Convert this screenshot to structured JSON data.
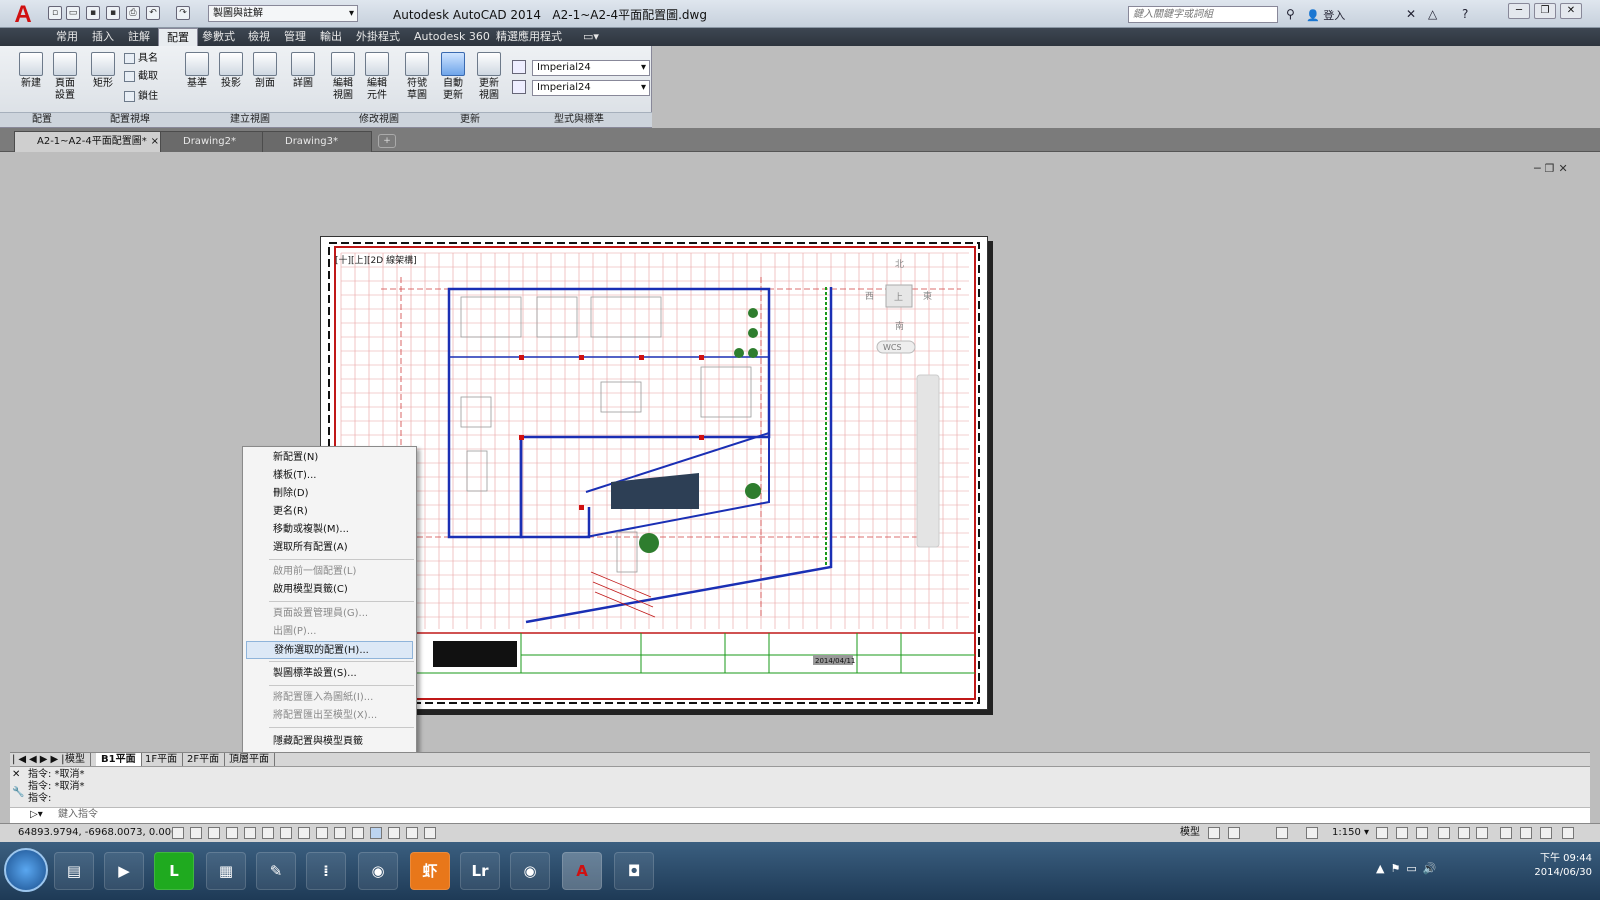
{
  "window": {
    "app_title": "Autodesk AutoCAD 2014",
    "file_name": "A2-1~A2-4平面配置圖.dwg",
    "workspace": "製圖與註解",
    "search_placeholder": "鍵入關鍵字或詞組",
    "login": "登入"
  },
  "menu_tabs": [
    "常用",
    "插入",
    "註解",
    "配置",
    "參數式",
    "檢視",
    "管理",
    "輸出",
    "外掛程式",
    "Autodesk 360",
    "精選應用程式"
  ],
  "ribbon": {
    "btn_new": "新建",
    "btn_page": "頁面 設置",
    "btn_rect": "矩形",
    "btn_named": "具名",
    "btn_clip": "截取",
    "btn_lock": "鎖住",
    "btn_base": "基準",
    "btn_proj": "投影",
    "btn_section": "剖面",
    "btn_detail": "詳圖",
    "btn_edit_view": "編輯 視圖",
    "btn_edit_comp": "編輯 元件",
    "btn_symbol": "符號 草圖",
    "btn_auto": "自動 更新",
    "btn_update": "更新 視圖",
    "style1": "Imperial24",
    "style2": "Imperial24",
    "panel_layout": "配置",
    "panel_vp": "配置視埠",
    "panel_create": "建立視圖",
    "panel_modify": "修改視圖",
    "panel_update": "更新",
    "panel_styles": "型式與標準"
  },
  "doc_tabs": [
    "A2-1~A2-4平面配置圖*",
    "Drawing2*",
    "Drawing3*"
  ],
  "drawing": {
    "view_label": "[十][上][2D 線架構]",
    "compass_n": "北",
    "compass_s": "南",
    "compass_e": "東",
    "compass_w": "西",
    "compass_top": "上",
    "wcs": "WCS",
    "date": "2014/04/11"
  },
  "context_menu": {
    "items": [
      {
        "label": "新配置(N)",
        "enabled": true
      },
      {
        "label": "樣板(T)...",
        "enabled": true
      },
      {
        "label": "刪除(D)",
        "enabled": true
      },
      {
        "label": "更名(R)",
        "enabled": true
      },
      {
        "label": "移動或複製(M)...",
        "enabled": true
      },
      {
        "label": "選取所有配置(A)",
        "enabled": true
      },
      {
        "label": "啟用前一個配置(L)",
        "enabled": false
      },
      {
        "label": "啟用模型頁籤(C)",
        "enabled": true
      },
      {
        "label": "頁面設置管理員(G)...",
        "enabled": false
      },
      {
        "label": "出圖(P)...",
        "enabled": false
      },
      {
        "label": "發佈選取的配置(H)...",
        "enabled": true
      },
      {
        "label": "製圖標準設置(S)...",
        "enabled": true
      },
      {
        "label": "將配置匯入為圖紙(I)...",
        "enabled": false
      },
      {
        "label": "將配置匯出至模型(X)...",
        "enabled": false
      },
      {
        "label": "隱藏配置與模型頁籤",
        "enabled": true
      }
    ]
  },
  "layout_tabs": [
    "模型",
    "B1平面",
    "1F平面",
    "2F平面",
    "頂層平面"
  ],
  "command": {
    "lines": [
      "指令: *取消*",
      "指令: *取消*",
      "指令:"
    ],
    "prompt": "鍵入指令"
  },
  "status": {
    "coords": "64893.9794, -6968.0073, 0.0000",
    "model": "模型",
    "scale": "1:150"
  },
  "taskbar": {
    "time": "下午 09:44",
    "date": "2014/06/30"
  },
  "colors": {
    "accent_red": "#d81e1e",
    "menubar": "#2e353e",
    "taskbar": "#1e3a56"
  }
}
